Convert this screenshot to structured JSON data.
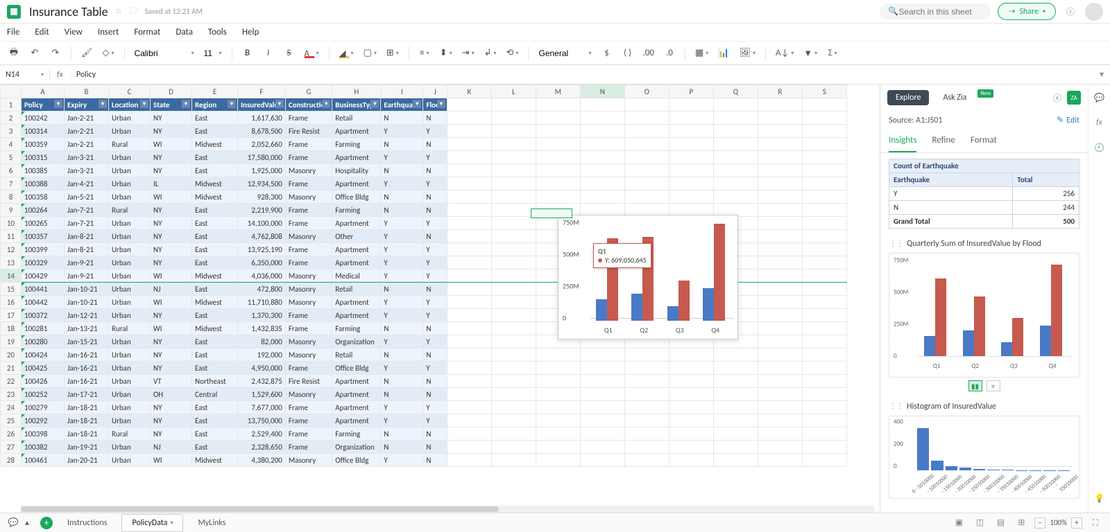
{
  "title": {
    "doc_name": "Insurance Table",
    "saved_text": "Saved at 12:21 AM",
    "search_placeholder": "Search in this sheet",
    "share_label": "Share"
  },
  "menus": [
    "File",
    "Edit",
    "View",
    "Insert",
    "Format",
    "Data",
    "Tools",
    "Help"
  ],
  "toolbar": {
    "font_name": "Calibri",
    "font_size": "11",
    "number_format": "General"
  },
  "namebox": "N14",
  "fx_value": "Policy",
  "cols": [
    "A",
    "B",
    "C",
    "D",
    "E",
    "F",
    "G",
    "H",
    "I",
    "J",
    "K",
    "L",
    "M",
    "N",
    "O",
    "P",
    "Q",
    "R",
    "S"
  ],
  "selected_col": "N",
  "selected_row": 14,
  "headers": [
    "Policy",
    "Expiry",
    "Location",
    "State",
    "Region",
    "InsuredValue",
    "Construction",
    "BusinessType",
    "Earthquake",
    "Flood"
  ],
  "rows": [
    {
      "n": 2,
      "c": [
        "100242",
        "Jan-2-21",
        "Urban",
        "NY",
        "East",
        "1,617,630",
        "Frame",
        "Retail",
        "N",
        "N"
      ]
    },
    {
      "n": 3,
      "c": [
        "100314",
        "Jan-2-21",
        "Urban",
        "NY",
        "East",
        "8,678,500",
        "Fire Resist",
        "Apartment",
        "Y",
        "Y"
      ]
    },
    {
      "n": 4,
      "c": [
        "100359",
        "Jan-2-21",
        "Rural",
        "WI",
        "Midwest",
        "2,052,660",
        "Frame",
        "Farming",
        "N",
        "N"
      ]
    },
    {
      "n": 5,
      "c": [
        "100315",
        "Jan-3-21",
        "Urban",
        "NY",
        "East",
        "17,580,000",
        "Frame",
        "Apartment",
        "Y",
        "Y"
      ]
    },
    {
      "n": 6,
      "c": [
        "100385",
        "Jan-3-21",
        "Urban",
        "NY",
        "East",
        "1,925,000",
        "Masonry",
        "Hospitality",
        "N",
        "N"
      ]
    },
    {
      "n": 7,
      "c": [
        "100388",
        "Jan-4-21",
        "Urban",
        "IL",
        "Midwest",
        "12,934,500",
        "Frame",
        "Apartment",
        "Y",
        "Y"
      ]
    },
    {
      "n": 8,
      "c": [
        "100358",
        "Jan-5-21",
        "Urban",
        "WI",
        "Midwest",
        "928,300",
        "Masonry",
        "Office Bldg",
        "N",
        "N"
      ]
    },
    {
      "n": 9,
      "c": [
        "100264",
        "Jan-7-21",
        "Rural",
        "NY",
        "East",
        "2,219,900",
        "Frame",
        "Farming",
        "N",
        "N"
      ]
    },
    {
      "n": 10,
      "c": [
        "100265",
        "Jan-7-21",
        "Urban",
        "NY",
        "East",
        "14,100,000",
        "Frame",
        "Apartment",
        "Y",
        "Y"
      ]
    },
    {
      "n": 11,
      "c": [
        "100357",
        "Jan-8-21",
        "Urban",
        "NY",
        "East",
        "4,762,808",
        "Masonry",
        "Other",
        "Y",
        "N"
      ]
    },
    {
      "n": 12,
      "c": [
        "100399",
        "Jan-8-21",
        "Urban",
        "NY",
        "East",
        "13,925,190",
        "Frame",
        "Apartment",
        "Y",
        "Y"
      ]
    },
    {
      "n": 13,
      "c": [
        "100329",
        "Jan-9-21",
        "Urban",
        "NY",
        "East",
        "6,350,000",
        "Frame",
        "Apartment",
        "Y",
        "Y"
      ]
    },
    {
      "n": 14,
      "c": [
        "100429",
        "Jan-9-21",
        "Urban",
        "WI",
        "Midwest",
        "4,036,000",
        "Masonry",
        "Medical",
        "Y",
        "Y"
      ]
    },
    {
      "n": 15,
      "c": [
        "100441",
        "Jan-10-21",
        "Urban",
        "NJ",
        "East",
        "472,800",
        "Masonry",
        "Retail",
        "N",
        "N"
      ]
    },
    {
      "n": 16,
      "c": [
        "100442",
        "Jan-10-21",
        "Urban",
        "WI",
        "Midwest",
        "11,710,880",
        "Masonry",
        "Apartment",
        "Y",
        "Y"
      ]
    },
    {
      "n": 17,
      "c": [
        "100372",
        "Jan-12-21",
        "Urban",
        "NY",
        "East",
        "1,370,300",
        "Frame",
        "Apartment",
        "Y",
        "Y"
      ]
    },
    {
      "n": 18,
      "c": [
        "100281",
        "Jan-13-21",
        "Rural",
        "WI",
        "Midwest",
        "1,432,835",
        "Frame",
        "Farming",
        "N",
        "N"
      ]
    },
    {
      "n": 19,
      "c": [
        "100280",
        "Jan-15-21",
        "Urban",
        "NY",
        "East",
        "82,000",
        "Masonry",
        "Organization",
        "Y",
        "Y"
      ]
    },
    {
      "n": 20,
      "c": [
        "100424",
        "Jan-16-21",
        "Urban",
        "NY",
        "East",
        "192,000",
        "Masonry",
        "Retail",
        "N",
        "N"
      ]
    },
    {
      "n": 21,
      "c": [
        "100425",
        "Jan-16-21",
        "Urban",
        "NY",
        "East",
        "4,950,000",
        "Frame",
        "Office Bldg",
        "Y",
        "Y"
      ]
    },
    {
      "n": 22,
      "c": [
        "100426",
        "Jan-16-21",
        "Urban",
        "VT",
        "Northeast",
        "2,432,875",
        "Fire Resist",
        "Apartment",
        "N",
        "N"
      ]
    },
    {
      "n": 23,
      "c": [
        "100252",
        "Jan-17-21",
        "Urban",
        "OH",
        "Central",
        "1,529,600",
        "Masonry",
        "Apartment",
        "N",
        "N"
      ]
    },
    {
      "n": 24,
      "c": [
        "100279",
        "Jan-18-21",
        "Urban",
        "NY",
        "East",
        "7,677,000",
        "Frame",
        "Apartment",
        "Y",
        "Y"
      ]
    },
    {
      "n": 25,
      "c": [
        "100292",
        "Jan-18-21",
        "Urban",
        "NY",
        "East",
        "13,750,000",
        "Frame",
        "Apartment",
        "Y",
        "Y"
      ]
    },
    {
      "n": 26,
      "c": [
        "100398",
        "Jan-18-21",
        "Rural",
        "NY",
        "East",
        "2,529,400",
        "Frame",
        "Farming",
        "N",
        "N"
      ]
    },
    {
      "n": 27,
      "c": [
        "100382",
        "Jan-19-21",
        "Urban",
        "NJ",
        "East",
        "2,328,650",
        "Frame",
        "Organization",
        "N",
        "N"
      ]
    },
    {
      "n": 28,
      "c": [
        "100461",
        "Jan-20-21",
        "Urban",
        "WI",
        "Midwest",
        "4,380,200",
        "Masonry",
        "Office Bldg",
        "Y",
        "N"
      ]
    }
  ],
  "embed_tooltip": {
    "label": "Q1",
    "value": "Y: 609,050,645"
  },
  "chart_data": {
    "embedded": {
      "type": "bar",
      "categories": [
        "Q1",
        "Q2",
        "Q3",
        "Q4"
      ],
      "series": [
        {
          "name": "N",
          "color": "#4a7ac6",
          "values": [
            160000000,
            200000000,
            110000000,
            240000000
          ]
        },
        {
          "name": "Y",
          "color": "#c65a4e",
          "values": [
            609050645,
            620000000,
            300000000,
            720000000
          ]
        }
      ],
      "ylim": [
        0,
        750000000
      ],
      "yticks": [
        "0",
        "250M",
        "500M",
        "750M"
      ]
    },
    "panel_bar": {
      "type": "bar",
      "title": "Quarterly Sum of InsuredValue by Flood",
      "categories": [
        "Q1",
        "Q2",
        "Q3",
        "Q4"
      ],
      "series": [
        {
          "name": "N",
          "color": "#4a7ac6",
          "values": [
            160000000,
            200000000,
            110000000,
            240000000
          ]
        },
        {
          "name": "Y",
          "color": "#c65a4e",
          "values": [
            609050645,
            470000000,
            300000000,
            720000000
          ]
        }
      ],
      "ylim": [
        0,
        750000000
      ],
      "yticks": [
        "0",
        "250M",
        "500M",
        "750M"
      ]
    },
    "panel_hist": {
      "type": "bar",
      "title": "Histogram of InsuredValue",
      "categories": [
        "0 - 5010000",
        "- 10010000",
        "- 15010000",
        "- 20010000",
        "- 25010000",
        "- 30010000",
        "- 35010000",
        "- 40010000",
        "- 45010000",
        "- 50010000",
        "- 55010000"
      ],
      "values": [
        380,
        90,
        40,
        25,
        15,
        8,
        5,
        3,
        2,
        1,
        1
      ],
      "ylim": [
        0,
        400
      ],
      "yticks": [
        "0",
        "200",
        "400"
      ]
    }
  },
  "panel": {
    "explore": "Explore",
    "askzia": "Ask Zia",
    "new_badge": "New",
    "source_label": "Source:",
    "source_range": "A1:J501",
    "edit": "Edit",
    "tabs": [
      "Insights",
      "Refine",
      "Format"
    ],
    "active_tab": "Insights",
    "count_table": {
      "title": "Count of Earthquake",
      "headers": [
        "Earthquake",
        "Total"
      ],
      "rows": [
        [
          "Y",
          "256"
        ],
        [
          "N",
          "244"
        ]
      ],
      "grand": [
        "Grand Total",
        "500"
      ]
    }
  },
  "sheet_tabs": [
    "Instructions",
    "PolicyData",
    "MyLinks"
  ],
  "active_sheet": "PolicyData",
  "zoom": "100%"
}
